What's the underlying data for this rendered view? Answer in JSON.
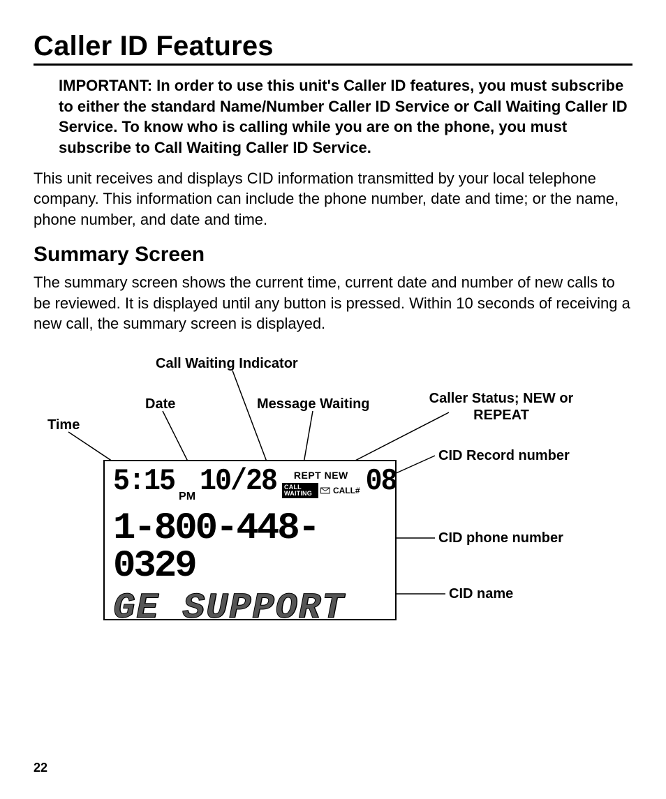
{
  "title": "Caller ID Features",
  "important": "IMPORTANT: In order to use this unit's Caller ID features, you must subscribe to either the standard Name/Number Caller ID Service or Call Waiting Caller ID Service. To know who is calling while you are on the phone, you must subscribe to Call Waiting Caller ID Service.",
  "intro": "This unit receives and displays CID information transmitted by your local telephone company. This information can include the phone number, date and time; or the name, phone number, and date and time.",
  "subtitle": "Summary Screen",
  "summary_body": "The summary screen shows the current time, current date and number of new calls to be reviewed. It is displayed until any button is pressed. Within 10 seconds of receiving a new call, the summary screen is displayed.",
  "callouts": {
    "call_waiting_indicator": "Call Waiting Indicator",
    "date": "Date",
    "time": "Time",
    "message_waiting": "Message Waiting",
    "caller_status": "Caller Status; NEW or\nREPEAT",
    "cid_record_number": "CID Record number",
    "cid_phone_number": "CID phone number",
    "cid_name": "CID name"
  },
  "lcd": {
    "time": "5:15",
    "ampm": "PM",
    "date": "10/28",
    "status_rept": "REPT",
    "status_new": "NEW",
    "call_waiting_badge": "CALL WAITING",
    "call_num_label": "CALL#",
    "record_number": "08",
    "phone_number": "1-800-448-0329",
    "caller_name": "GE SUPPORT"
  },
  "page_number": "22"
}
